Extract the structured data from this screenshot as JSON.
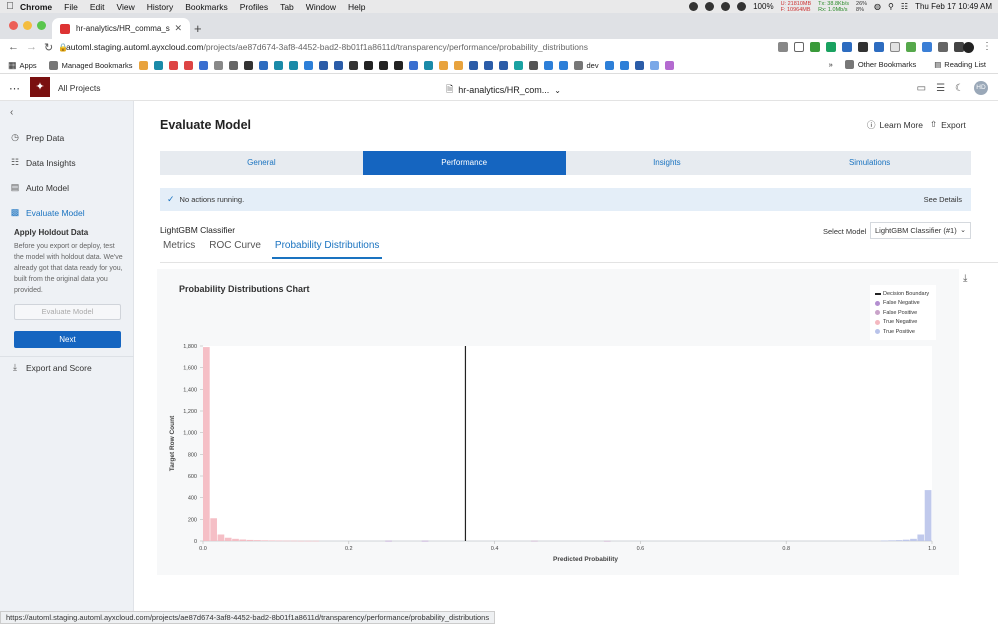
{
  "os_menu": {
    "app": "Chrome",
    "items": [
      "File",
      "Edit",
      "View",
      "History",
      "Bookmarks",
      "Profiles",
      "Tab",
      "Window",
      "Help"
    ],
    "battery": "100%",
    "clock": "Thu Feb 17  10:49 AM",
    "net_u": "U: 21810MB",
    "net_f": "F: 10964MB",
    "net_tx": "Tx: 38.8Kb/s",
    "net_rx": "Rx: 1.0Mb/s",
    "cpu_a": "26%",
    "cpu_b": "8%"
  },
  "browser": {
    "tab_title": "hr-analytics/HR_comma_sep...",
    "url_host": "automl.staging.automl.ayxcloud.com",
    "url_path": "/projects/ae87d674-3af8-4452-bad2-8b01f1a8611d/transparency/performance/probability_distributions",
    "bookmarks": {
      "apps": "Apps",
      "managed": "Managed Bookmarks",
      "dev": "dev",
      "other": "Other Bookmarks",
      "reading": "Reading List"
    },
    "status_url": "https://automl.staging.automl.ayxcloud.com/projects/ae87d674-3af8-4452-bad2-8b01f1a8611d/transparency/performance/probability_distributions"
  },
  "app_header": {
    "all_projects": "All Projects",
    "file_title": "hr-analytics/HR_com...",
    "avatar": "HD"
  },
  "sidebar": {
    "items": [
      {
        "label": "Prep Data",
        "icon": "clock-icon"
      },
      {
        "label": "Data Insights",
        "icon": "insights-icon"
      },
      {
        "label": "Auto Model",
        "icon": "layers-icon"
      },
      {
        "label": "Evaluate Model",
        "icon": "chart-icon"
      }
    ],
    "holdout_title": "Apply Holdout Data",
    "holdout_text": "Before you export or deploy, test the model with holdout data. We've already got that data ready for you, built from the original data you provided.",
    "evaluate_btn": "Evaluate Model",
    "next_btn": "Next",
    "export_score": "Export and Score"
  },
  "main": {
    "title": "Evaluate Model",
    "learn_more": "Learn More",
    "export": "Export",
    "tabs": [
      "General",
      "Performance",
      "Insights",
      "Simulations"
    ],
    "active_tab": "Performance",
    "status_text": "No actions running.",
    "see_details": "See Details",
    "model_name": "LightGBM Classifier",
    "select_label": "Select Model",
    "selected_model": "LightGBM Classifier (#1)",
    "subtabs": [
      "Metrics",
      "ROC Curve",
      "Probability Distributions"
    ],
    "active_subtab": "Probability Distributions"
  },
  "chart_data": {
    "type": "bar",
    "title": "Probability Distributions Chart",
    "xlabel": "Predicted Probability",
    "ylabel": "Target Row Count",
    "xlim": [
      0,
      1
    ],
    "ylim": [
      0,
      1800
    ],
    "x_ticks": [
      "0.0",
      "0.2",
      "0.4",
      "0.6",
      "0.8",
      "1.0"
    ],
    "y_ticks": [
      "0",
      "200",
      "400",
      "600",
      "800",
      "1,000",
      "1,200",
      "1,400",
      "1,600",
      "1,800"
    ],
    "decision_boundary": 0.36,
    "bin_width": 0.01,
    "legend": [
      {
        "name": "Decision Boundary",
        "color": "#222222",
        "kind": "line"
      },
      {
        "name": "False Negative",
        "color": "#b48fd0",
        "kind": "dot"
      },
      {
        "name": "False Positive",
        "color": "#c9a3c9",
        "kind": "dot"
      },
      {
        "name": "True Negative",
        "color": "#f4b8c0",
        "kind": "dot"
      },
      {
        "name": "True Positive",
        "color": "#b9c3ea",
        "kind": "dot"
      }
    ],
    "series": [
      {
        "name": "True Negative",
        "color": "#f4b8c0",
        "x": [
          0.0,
          0.01,
          0.02,
          0.03,
          0.04,
          0.05,
          0.06,
          0.07,
          0.08,
          0.09,
          0.1,
          0.11,
          0.12,
          0.13,
          0.14,
          0.15
        ],
        "values": [
          1790,
          210,
          60,
          30,
          20,
          14,
          10,
          8,
          6,
          5,
          4,
          3,
          3,
          2,
          2,
          2
        ]
      },
      {
        "name": "True Positive",
        "color": "#b9c3ea",
        "x": [
          0.93,
          0.94,
          0.95,
          0.96,
          0.97,
          0.98,
          0.99
        ],
        "values": [
          4,
          6,
          8,
          12,
          20,
          60,
          470
        ]
      },
      {
        "name": "False Negative",
        "color": "#b48fd0",
        "x": [
          0.25,
          0.3
        ],
        "values": [
          2,
          2
        ]
      },
      {
        "name": "False Positive",
        "color": "#c9a3c9",
        "x": [
          0.45,
          0.55
        ],
        "values": [
          2,
          1
        ]
      }
    ]
  },
  "colors": {
    "accent": "#1565c0",
    "sidebar_bg": "#eef1f5",
    "status_bg": "#e4eef8"
  }
}
